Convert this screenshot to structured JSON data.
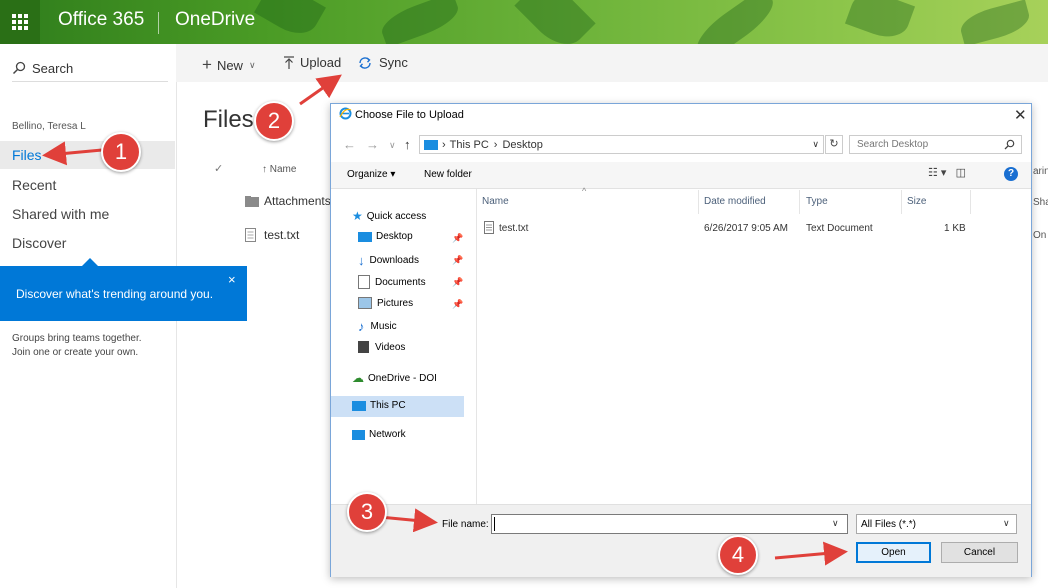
{
  "topbar": {
    "brand": "Office 365",
    "app": "OneDrive"
  },
  "leftnav": {
    "search_label": "Search",
    "user": "Bellino, Teresa L",
    "items": [
      {
        "label": "Files"
      },
      {
        "label": "Recent"
      },
      {
        "label": "Shared with me"
      },
      {
        "label": "Discover"
      }
    ],
    "callout": {
      "text": "Discover what's trending around you.",
      "close": "×"
    },
    "groups_line1": "Groups bring teams together.",
    "groups_line2": "Join one or create your own."
  },
  "commandbar": {
    "new": "New",
    "upload": "Upload",
    "sync": "Sync"
  },
  "files": {
    "title": "Files",
    "sort_col": "↑ Name",
    "rows": [
      {
        "name": "Attachments"
      },
      {
        "name": "test.txt"
      }
    ],
    "right_col_fragments": [
      "aring",
      "Sha",
      "On"
    ]
  },
  "dialog": {
    "title": "Choose File to Upload",
    "close": "✕",
    "breadcrumb": [
      "This PC",
      "Desktop"
    ],
    "search_placeholder": "Search Desktop",
    "toolbar": {
      "organize": "Organize ▾",
      "new_folder": "New folder"
    },
    "nav": [
      {
        "label": "Quick access"
      },
      {
        "label": "Desktop"
      },
      {
        "label": "Downloads"
      },
      {
        "label": "Documents"
      },
      {
        "label": "Pictures"
      },
      {
        "label": "Music"
      },
      {
        "label": "Videos"
      },
      {
        "label": "OneDrive - DOI"
      },
      {
        "label": "This PC"
      },
      {
        "label": "Network"
      }
    ],
    "columns": {
      "name": "Name",
      "date": "Date modified",
      "type": "Type",
      "size": "Size"
    },
    "files": [
      {
        "name": "test.txt",
        "date": "6/26/2017 9:05 AM",
        "type": "Text Document",
        "size": "1 KB"
      }
    ],
    "filename_label": "File name:",
    "filename_value": "",
    "filter": "All Files (*.*)",
    "open": "Open",
    "cancel": "Cancel"
  },
  "annotations": [
    "1",
    "2",
    "3",
    "4"
  ],
  "colors": {
    "accent": "#0078d7",
    "badge": "#e0403a",
    "topbar": "#4a9b25"
  }
}
